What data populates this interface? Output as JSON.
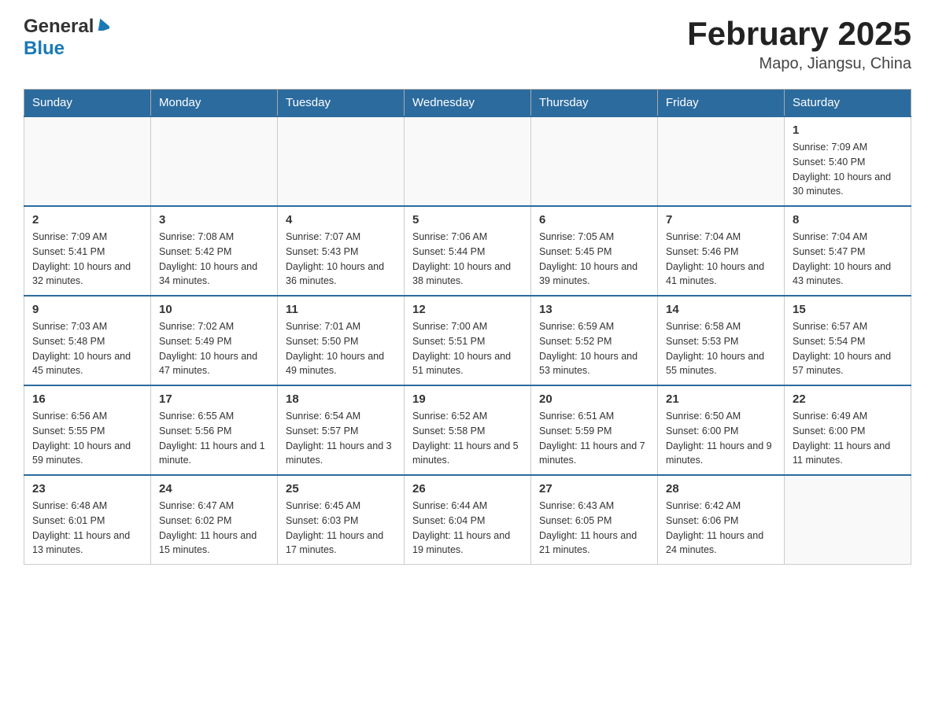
{
  "header": {
    "logo_general": "General",
    "logo_blue": "Blue",
    "month_title": "February 2025",
    "location": "Mapo, Jiangsu, China"
  },
  "weekdays": [
    "Sunday",
    "Monday",
    "Tuesday",
    "Wednesday",
    "Thursday",
    "Friday",
    "Saturday"
  ],
  "weeks": [
    [
      {
        "day": "",
        "info": ""
      },
      {
        "day": "",
        "info": ""
      },
      {
        "day": "",
        "info": ""
      },
      {
        "day": "",
        "info": ""
      },
      {
        "day": "",
        "info": ""
      },
      {
        "day": "",
        "info": ""
      },
      {
        "day": "1",
        "info": "Sunrise: 7:09 AM\nSunset: 5:40 PM\nDaylight: 10 hours and 30 minutes."
      }
    ],
    [
      {
        "day": "2",
        "info": "Sunrise: 7:09 AM\nSunset: 5:41 PM\nDaylight: 10 hours and 32 minutes."
      },
      {
        "day": "3",
        "info": "Sunrise: 7:08 AM\nSunset: 5:42 PM\nDaylight: 10 hours and 34 minutes."
      },
      {
        "day": "4",
        "info": "Sunrise: 7:07 AM\nSunset: 5:43 PM\nDaylight: 10 hours and 36 minutes."
      },
      {
        "day": "5",
        "info": "Sunrise: 7:06 AM\nSunset: 5:44 PM\nDaylight: 10 hours and 38 minutes."
      },
      {
        "day": "6",
        "info": "Sunrise: 7:05 AM\nSunset: 5:45 PM\nDaylight: 10 hours and 39 minutes."
      },
      {
        "day": "7",
        "info": "Sunrise: 7:04 AM\nSunset: 5:46 PM\nDaylight: 10 hours and 41 minutes."
      },
      {
        "day": "8",
        "info": "Sunrise: 7:04 AM\nSunset: 5:47 PM\nDaylight: 10 hours and 43 minutes."
      }
    ],
    [
      {
        "day": "9",
        "info": "Sunrise: 7:03 AM\nSunset: 5:48 PM\nDaylight: 10 hours and 45 minutes."
      },
      {
        "day": "10",
        "info": "Sunrise: 7:02 AM\nSunset: 5:49 PM\nDaylight: 10 hours and 47 minutes."
      },
      {
        "day": "11",
        "info": "Sunrise: 7:01 AM\nSunset: 5:50 PM\nDaylight: 10 hours and 49 minutes."
      },
      {
        "day": "12",
        "info": "Sunrise: 7:00 AM\nSunset: 5:51 PM\nDaylight: 10 hours and 51 minutes."
      },
      {
        "day": "13",
        "info": "Sunrise: 6:59 AM\nSunset: 5:52 PM\nDaylight: 10 hours and 53 minutes."
      },
      {
        "day": "14",
        "info": "Sunrise: 6:58 AM\nSunset: 5:53 PM\nDaylight: 10 hours and 55 minutes."
      },
      {
        "day": "15",
        "info": "Sunrise: 6:57 AM\nSunset: 5:54 PM\nDaylight: 10 hours and 57 minutes."
      }
    ],
    [
      {
        "day": "16",
        "info": "Sunrise: 6:56 AM\nSunset: 5:55 PM\nDaylight: 10 hours and 59 minutes."
      },
      {
        "day": "17",
        "info": "Sunrise: 6:55 AM\nSunset: 5:56 PM\nDaylight: 11 hours and 1 minute."
      },
      {
        "day": "18",
        "info": "Sunrise: 6:54 AM\nSunset: 5:57 PM\nDaylight: 11 hours and 3 minutes."
      },
      {
        "day": "19",
        "info": "Sunrise: 6:52 AM\nSunset: 5:58 PM\nDaylight: 11 hours and 5 minutes."
      },
      {
        "day": "20",
        "info": "Sunrise: 6:51 AM\nSunset: 5:59 PM\nDaylight: 11 hours and 7 minutes."
      },
      {
        "day": "21",
        "info": "Sunrise: 6:50 AM\nSunset: 6:00 PM\nDaylight: 11 hours and 9 minutes."
      },
      {
        "day": "22",
        "info": "Sunrise: 6:49 AM\nSunset: 6:00 PM\nDaylight: 11 hours and 11 minutes."
      }
    ],
    [
      {
        "day": "23",
        "info": "Sunrise: 6:48 AM\nSunset: 6:01 PM\nDaylight: 11 hours and 13 minutes."
      },
      {
        "day": "24",
        "info": "Sunrise: 6:47 AM\nSunset: 6:02 PM\nDaylight: 11 hours and 15 minutes."
      },
      {
        "day": "25",
        "info": "Sunrise: 6:45 AM\nSunset: 6:03 PM\nDaylight: 11 hours and 17 minutes."
      },
      {
        "day": "26",
        "info": "Sunrise: 6:44 AM\nSunset: 6:04 PM\nDaylight: 11 hours and 19 minutes."
      },
      {
        "day": "27",
        "info": "Sunrise: 6:43 AM\nSunset: 6:05 PM\nDaylight: 11 hours and 21 minutes."
      },
      {
        "day": "28",
        "info": "Sunrise: 6:42 AM\nSunset: 6:06 PM\nDaylight: 11 hours and 24 minutes."
      },
      {
        "day": "",
        "info": ""
      }
    ]
  ]
}
